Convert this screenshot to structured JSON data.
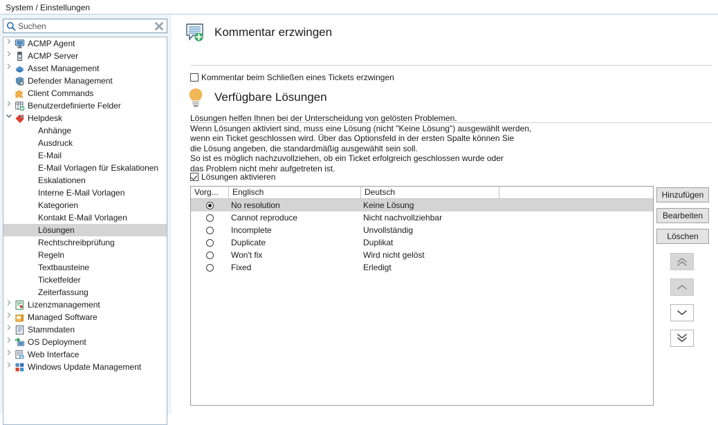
{
  "window": {
    "title": "System / Einstellungen"
  },
  "sidebar": {
    "search": {
      "placeholder": "Suchen",
      "value": "",
      "icon": "search-icon",
      "clear_icon": "clear-icon"
    },
    "items": [
      {
        "label": "ACMP Agent",
        "indent": 0,
        "chevron": "right",
        "icon": "monitor-icon",
        "selected": false
      },
      {
        "label": "ACMP Server",
        "indent": 0,
        "chevron": "right",
        "icon": "server-icon",
        "selected": false
      },
      {
        "label": "Asset Management",
        "indent": 0,
        "chevron": "right",
        "icon": "book-icon",
        "selected": false
      },
      {
        "label": "Defender Management",
        "indent": 0,
        "chevron": "none",
        "icon": "shield-gear-icon",
        "selected": false
      },
      {
        "label": "Client Commands",
        "indent": 0,
        "chevron": "none",
        "icon": "puzzle-icon",
        "selected": false
      },
      {
        "label": "Benutzerdefinierte Felder",
        "indent": 0,
        "chevron": "right",
        "icon": "table-plus-icon",
        "selected": false
      },
      {
        "label": "Helpdesk",
        "indent": 0,
        "chevron": "down",
        "icon": "tag-icon",
        "selected": false
      },
      {
        "label": "Anhänge",
        "indent": 1,
        "chevron": "none",
        "icon": "none",
        "selected": false
      },
      {
        "label": "Ausdruck",
        "indent": 1,
        "chevron": "none",
        "icon": "none",
        "selected": false
      },
      {
        "label": "E-Mail",
        "indent": 1,
        "chevron": "none",
        "icon": "none",
        "selected": false
      },
      {
        "label": "E-Mail Vorlagen für Eskalationen",
        "indent": 1,
        "chevron": "none",
        "icon": "none",
        "selected": false
      },
      {
        "label": "Eskalationen",
        "indent": 1,
        "chevron": "none",
        "icon": "none",
        "selected": false
      },
      {
        "label": "Interne E-Mail Vorlagen",
        "indent": 1,
        "chevron": "none",
        "icon": "none",
        "selected": false
      },
      {
        "label": "Kategorien",
        "indent": 1,
        "chevron": "none",
        "icon": "none",
        "selected": false
      },
      {
        "label": "Kontakt E-Mail Vorlagen",
        "indent": 1,
        "chevron": "none",
        "icon": "none",
        "selected": false
      },
      {
        "label": "Lösungen",
        "indent": 1,
        "chevron": "none",
        "icon": "none",
        "selected": true
      },
      {
        "label": "Rechtschreibprüfung",
        "indent": 1,
        "chevron": "none",
        "icon": "none",
        "selected": false
      },
      {
        "label": "Regeln",
        "indent": 1,
        "chevron": "none",
        "icon": "none",
        "selected": false
      },
      {
        "label": "Textbausteine",
        "indent": 1,
        "chevron": "none",
        "icon": "none",
        "selected": false
      },
      {
        "label": "Ticketfelder",
        "indent": 1,
        "chevron": "none",
        "icon": "none",
        "selected": false
      },
      {
        "label": "Zeiterfassung",
        "indent": 1,
        "chevron": "none",
        "icon": "none",
        "selected": false
      },
      {
        "label": "Lizenzmanagement",
        "indent": 0,
        "chevron": "right",
        "icon": "license-icon",
        "selected": false
      },
      {
        "label": "Managed Software",
        "indent": 0,
        "chevron": "right",
        "icon": "box-icon",
        "selected": false
      },
      {
        "label": "Stammdaten",
        "indent": 0,
        "chevron": "right",
        "icon": "list-icon",
        "selected": false
      },
      {
        "label": "OS Deployment",
        "indent": 0,
        "chevron": "right",
        "icon": "deploy-icon",
        "selected": false
      },
      {
        "label": "Web Interface",
        "indent": 0,
        "chevron": "right",
        "icon": "web-icon",
        "selected": false
      },
      {
        "label": "Windows Update Management",
        "indent": 0,
        "chevron": "right",
        "icon": "windows-update-icon",
        "selected": false
      }
    ]
  },
  "content": {
    "section_comment": {
      "icon": "comment-plus-icon",
      "title": "Kommentar erzwingen",
      "checkbox": {
        "label": "Kommentar beim Schließen eines Tickets erzwingen",
        "checked": false
      }
    },
    "section_solutions": {
      "icon": "lightbulb-icon",
      "title": "Verfügbare Lösungen",
      "description": "Lösungen helfen Ihnen bei der Unterscheidung von gelösten Problemen.\nWenn Lösungen aktiviert sind, muss eine Lösung (nicht \"Keine Lösung\") ausgewählt werden,\nwenn ein Ticket geschlossen wird. Über das Optionsfeld in der ersten Spalte können Sie\ndie Lösung angeben, die standardmäßig ausgewählt sein soll.\nSo ist es möglich nachzuvollziehen, ob ein Ticket erfolgreich geschlossen wurde oder\ndas Problem nicht mehr aufgetreten ist.",
      "checkbox": {
        "label": "Lösungen aktivieren",
        "checked": true
      }
    },
    "table": {
      "columns": [
        "Vorg...",
        "Englisch",
        "Deutsch"
      ],
      "rows": [
        {
          "default": true,
          "english": "No resolution",
          "german": "Keine Lösung",
          "selected": true
        },
        {
          "default": false,
          "english": "Cannot reproduce",
          "german": "Nicht nachvollziehbar",
          "selected": false
        },
        {
          "default": false,
          "english": "Incomplete",
          "german": "Unvollständig",
          "selected": false
        },
        {
          "default": false,
          "english": "Duplicate",
          "german": "Duplikat",
          "selected": false
        },
        {
          "default": false,
          "english": "Won't fix",
          "german": "Wird nicht gelöst",
          "selected": false
        },
        {
          "default": false,
          "english": "Fixed",
          "german": "Erledigt",
          "selected": false
        }
      ]
    },
    "buttons": {
      "add": "Hinzufügen",
      "edit": "Bearbeiten",
      "delete": "Löschen",
      "move_top": {
        "icon": "double-chevron-up-icon",
        "enabled": false
      },
      "move_up": {
        "icon": "chevron-up-icon",
        "enabled": false
      },
      "move_down": {
        "icon": "chevron-down-icon",
        "enabled": true
      },
      "move_bottom": {
        "icon": "double-chevron-down-icon",
        "enabled": true
      }
    }
  },
  "colors": {
    "panel_bg": "#eef4f8",
    "selection": "#d4d4d4",
    "accent_blue": "#2b6cb0",
    "bulb_orange": "#f0b755"
  }
}
